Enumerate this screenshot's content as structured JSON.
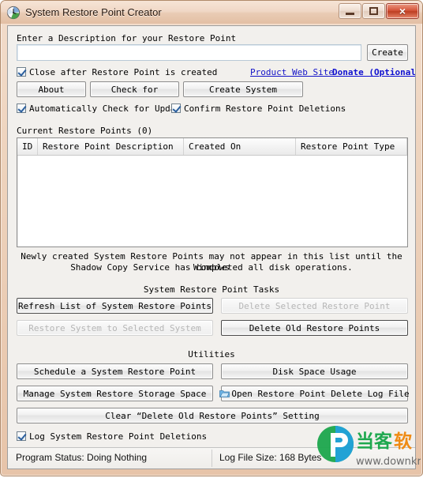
{
  "window": {
    "title": "System Restore Point Creator",
    "app_icon": "clock-restore-icon",
    "controls": {
      "minimize": "minimize-icon",
      "maximize": "maximize-icon",
      "close": "×"
    }
  },
  "form": {
    "description_label": "Enter a Description for your Restore Point",
    "description_value": "",
    "description_placeholder": "",
    "create_button": "Create",
    "close_after_checkbox": "Close after Restore Point is created",
    "product_web_site_link": "Product Web Site",
    "donate_link": "Donate (Optional)"
  },
  "buttons_row": [
    {
      "label": "About",
      "name": "about-button"
    },
    {
      "label": "Check for",
      "name": "check-for-updates-button"
    },
    {
      "label": "Create System",
      "name": "create-system-button"
    }
  ],
  "checkboxes_row": [
    {
      "label": "Automatically Check for Updates",
      "name": "auto-check-updates-checkbox",
      "checked": true
    },
    {
      "label": "Confirm Restore Point Deletions",
      "name": "confirm-deletions-checkbox",
      "checked": true
    }
  ],
  "list": {
    "group_label": "Current Restore Points (0)",
    "columns": [
      "ID",
      "Restore Point Description",
      "Created On",
      "Restore Point Type"
    ],
    "rows": []
  },
  "note": {
    "line1": "Newly created System Restore Points may not appear in this list until the Windows",
    "line2": "Shadow Copy Service has completed all disk operations."
  },
  "tasks": {
    "title": "System Restore Point Tasks",
    "refresh_list": "Refresh List of System Restore Points",
    "delete_selected": "Delete Selected Restore Point",
    "restore_system": "Restore System to Selected System",
    "delete_old": "Delete Old Restore Points"
  },
  "utilities": {
    "title": "Utilities",
    "schedule": "Schedule a System Restore Point",
    "disk_space": "Disk Space Usage",
    "manage_storage": "Manage System Restore Storage Space",
    "open_log": "Open Restore Point Delete Log File",
    "open_log_icon": "log-file-icon",
    "clear_setting": "Clear “Delete Old Restore Points” Setting"
  },
  "log_checkbox": {
    "label": "Log System Restore Point Deletions",
    "checked": true
  },
  "statusbar": {
    "program_status": "Program Status:  Doing Nothing",
    "log_file_size": "Log File Size:  168 Bytes"
  },
  "watermark": {
    "cn_text": "当客软件园",
    "url_text": "www.downkr.com"
  },
  "colors": {
    "titlebar": "#eed3bd",
    "client": "#f2f0ed",
    "link": "#1414c8",
    "close_button": "#c4452c"
  }
}
